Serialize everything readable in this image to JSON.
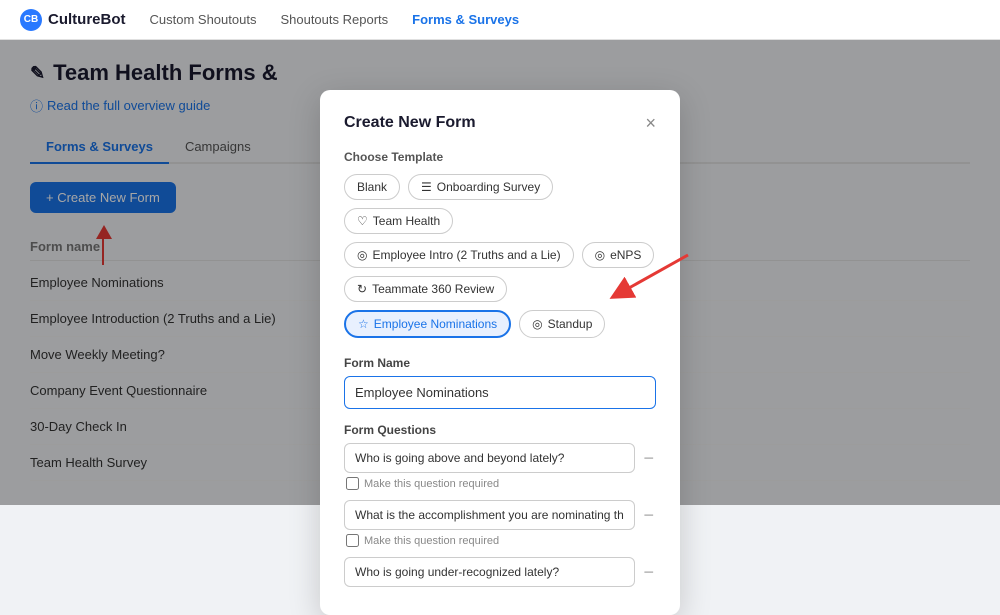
{
  "brand": {
    "name": "CultureBot",
    "icon": "CB"
  },
  "nav": {
    "links": [
      {
        "label": "Custom Shoutouts",
        "active": false
      },
      {
        "label": "Shoutouts Reports",
        "active": false
      },
      {
        "label": "Forms & Surveys",
        "active": true
      }
    ]
  },
  "page": {
    "title": "Team Health Forms &",
    "title_icon": "✎",
    "overview_link": "Read the full overview guide"
  },
  "tabs": [
    {
      "label": "Forms & Surveys",
      "active": true
    },
    {
      "label": "Campaigns",
      "active": false
    }
  ],
  "create_button": "+ Create New Form",
  "table": {
    "header": "Form name",
    "rows": [
      "Employee Nominations",
      "Employee Introduction (2 Truths and a Lie)",
      "Move Weekly Meeting?",
      "Company Event Questionnaire",
      "30-Day Check In",
      "Team Health Survey"
    ]
  },
  "modal": {
    "title": "Create New Form",
    "close": "×",
    "choose_template_label": "Choose Template",
    "templates": [
      {
        "label": "Blank",
        "icon": "",
        "selected": false
      },
      {
        "label": "Onboarding Survey",
        "icon": "☰",
        "selected": false
      },
      {
        "label": "Team Health",
        "icon": "♡",
        "selected": false
      },
      {
        "label": "Employee Intro (2 Truths and a Lie)",
        "icon": "◎",
        "selected": false
      },
      {
        "label": "eNPS",
        "icon": "◎",
        "selected": false
      },
      {
        "label": "Teammate 360 Review",
        "icon": "↻",
        "selected": false
      },
      {
        "label": "Employee Nominations",
        "icon": "☆",
        "selected": true
      },
      {
        "label": "Standup",
        "icon": "◎",
        "selected": false
      }
    ],
    "form_name_label": "Form Name",
    "form_name_value": "Employee Nominations",
    "form_name_placeholder": "Employee Nominations",
    "questions_label": "Form Questions",
    "questions": [
      {
        "value": "Who is going above and beyond lately?",
        "required_label": "Make this question required"
      },
      {
        "value": "What is the accomplishment you are nominating them for?",
        "required_label": "Make this question required"
      },
      {
        "value": "Who is going under-recognized lately?",
        "required_label": ""
      }
    ]
  }
}
